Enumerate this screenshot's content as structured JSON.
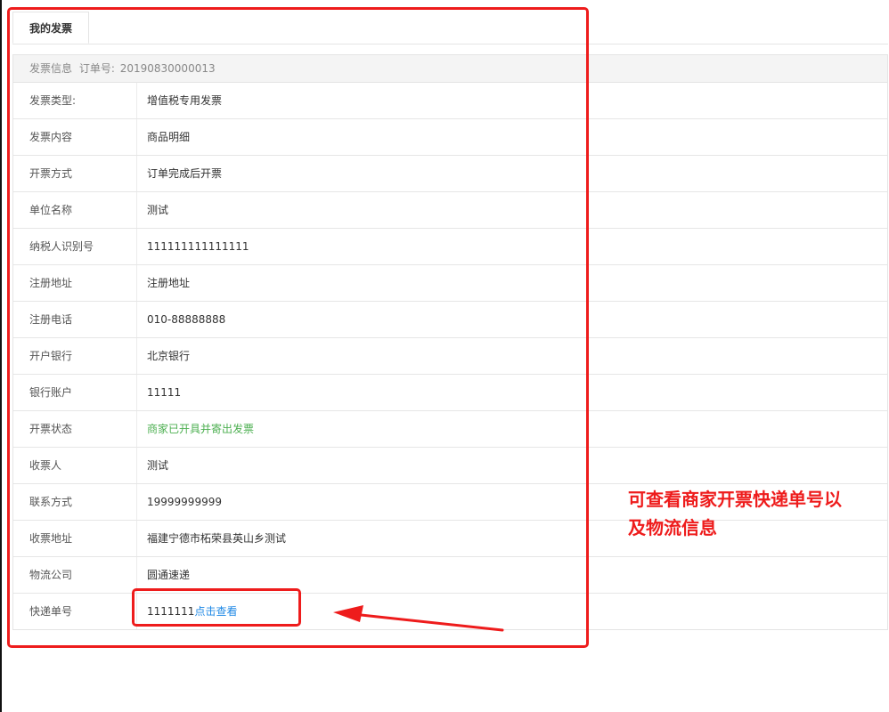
{
  "tab": {
    "label": "我的发票"
  },
  "header": {
    "section_title": "发票信息",
    "order_label": "订单号:",
    "order_no": "20190830000013"
  },
  "rows": [
    {
      "label": "发票类型:",
      "value": "增值税专用发票"
    },
    {
      "label": "发票内容",
      "value": "商品明细"
    },
    {
      "label": "开票方式",
      "value": "订单完成后开票"
    },
    {
      "label": "单位名称",
      "value": "测试"
    },
    {
      "label": "纳税人识别号",
      "value": "111111111111111"
    },
    {
      "label": "注册地址",
      "value": "注册地址"
    },
    {
      "label": "注册电话",
      "value": "010-88888888"
    },
    {
      "label": "开户银行",
      "value": "北京银行"
    },
    {
      "label": "银行账户",
      "value": "11111"
    },
    {
      "label": "开票状态",
      "value": "商家已开具并寄出发票"
    },
    {
      "label": "收票人",
      "value": "测试"
    },
    {
      "label": "联系方式",
      "value": "19999999999"
    },
    {
      "label": "收票地址",
      "value": "福建宁德市柘荣县英山乡测试"
    },
    {
      "label": "物流公司",
      "value": "圆通速递"
    },
    {
      "label": "快递单号",
      "value": "1111111",
      "link": "点击查看"
    }
  ],
  "annotation": {
    "line1": "可查看商家开票快递单号以",
    "line2": "及物流信息"
  },
  "colors": {
    "status_green": "#4caf50",
    "link_blue": "#1e88e5",
    "annotation_red": "#ee1c1c"
  }
}
